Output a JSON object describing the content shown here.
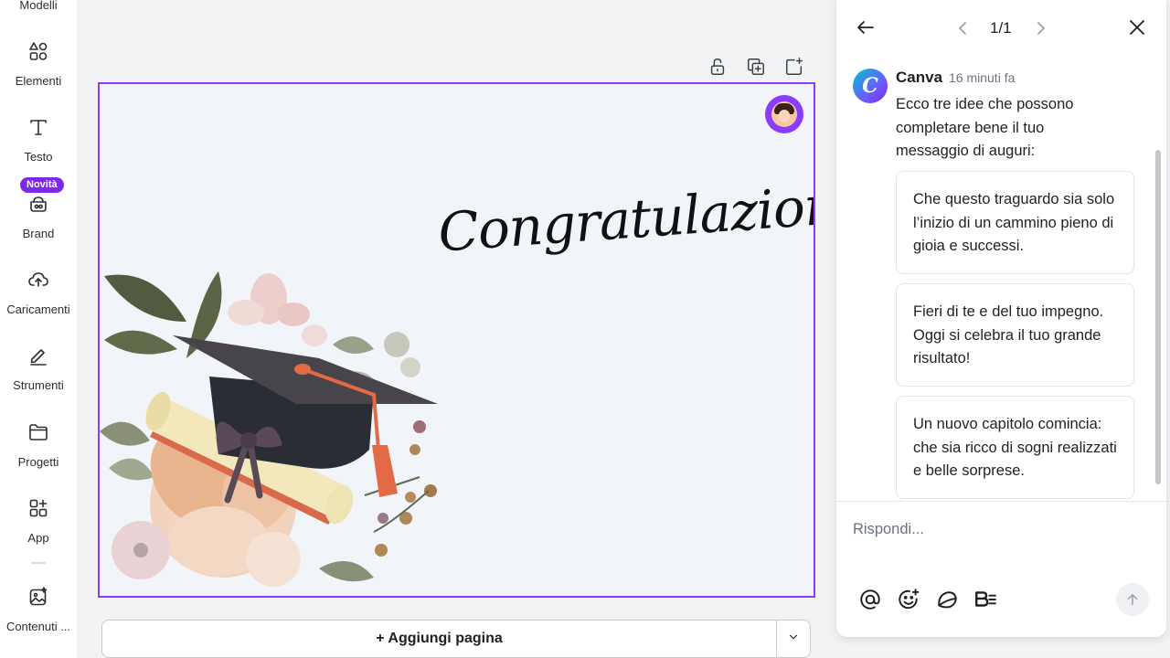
{
  "sidebar": {
    "items": [
      {
        "label": "Modelli"
      },
      {
        "label": "Elementi"
      },
      {
        "label": "Testo"
      },
      {
        "label": "Brand",
        "badge": "Novità"
      },
      {
        "label": "Caricamenti"
      },
      {
        "label": "Strumenti"
      },
      {
        "label": "Progetti"
      },
      {
        "label": "App"
      },
      {
        "label": "Contenuti ..."
      }
    ]
  },
  "canvas": {
    "greeting": "Congratulazioni!",
    "add_page_label": "+ Aggiungi pagina",
    "accent_color": "#8b3dff"
  },
  "panel": {
    "pager": "1/1",
    "author": "Canva",
    "time": "16 minuti fa",
    "message": "Ecco tre idee che possono completare bene il tuo messaggio di auguri:",
    "suggestions": [
      {
        "text": "Che questo traguardo sia solo l’inizio di un cammino pieno di gioia e successi."
      },
      {
        "text": "Fieri di te e del tuo impegno. Oggi si celebra il tuo grande risultato!"
      },
      {
        "text": "Un nuovo capitolo comincia: che sia ricco di sogni realizzati e belle sorprese."
      }
    ],
    "reply_placeholder": "Rispondi..."
  }
}
